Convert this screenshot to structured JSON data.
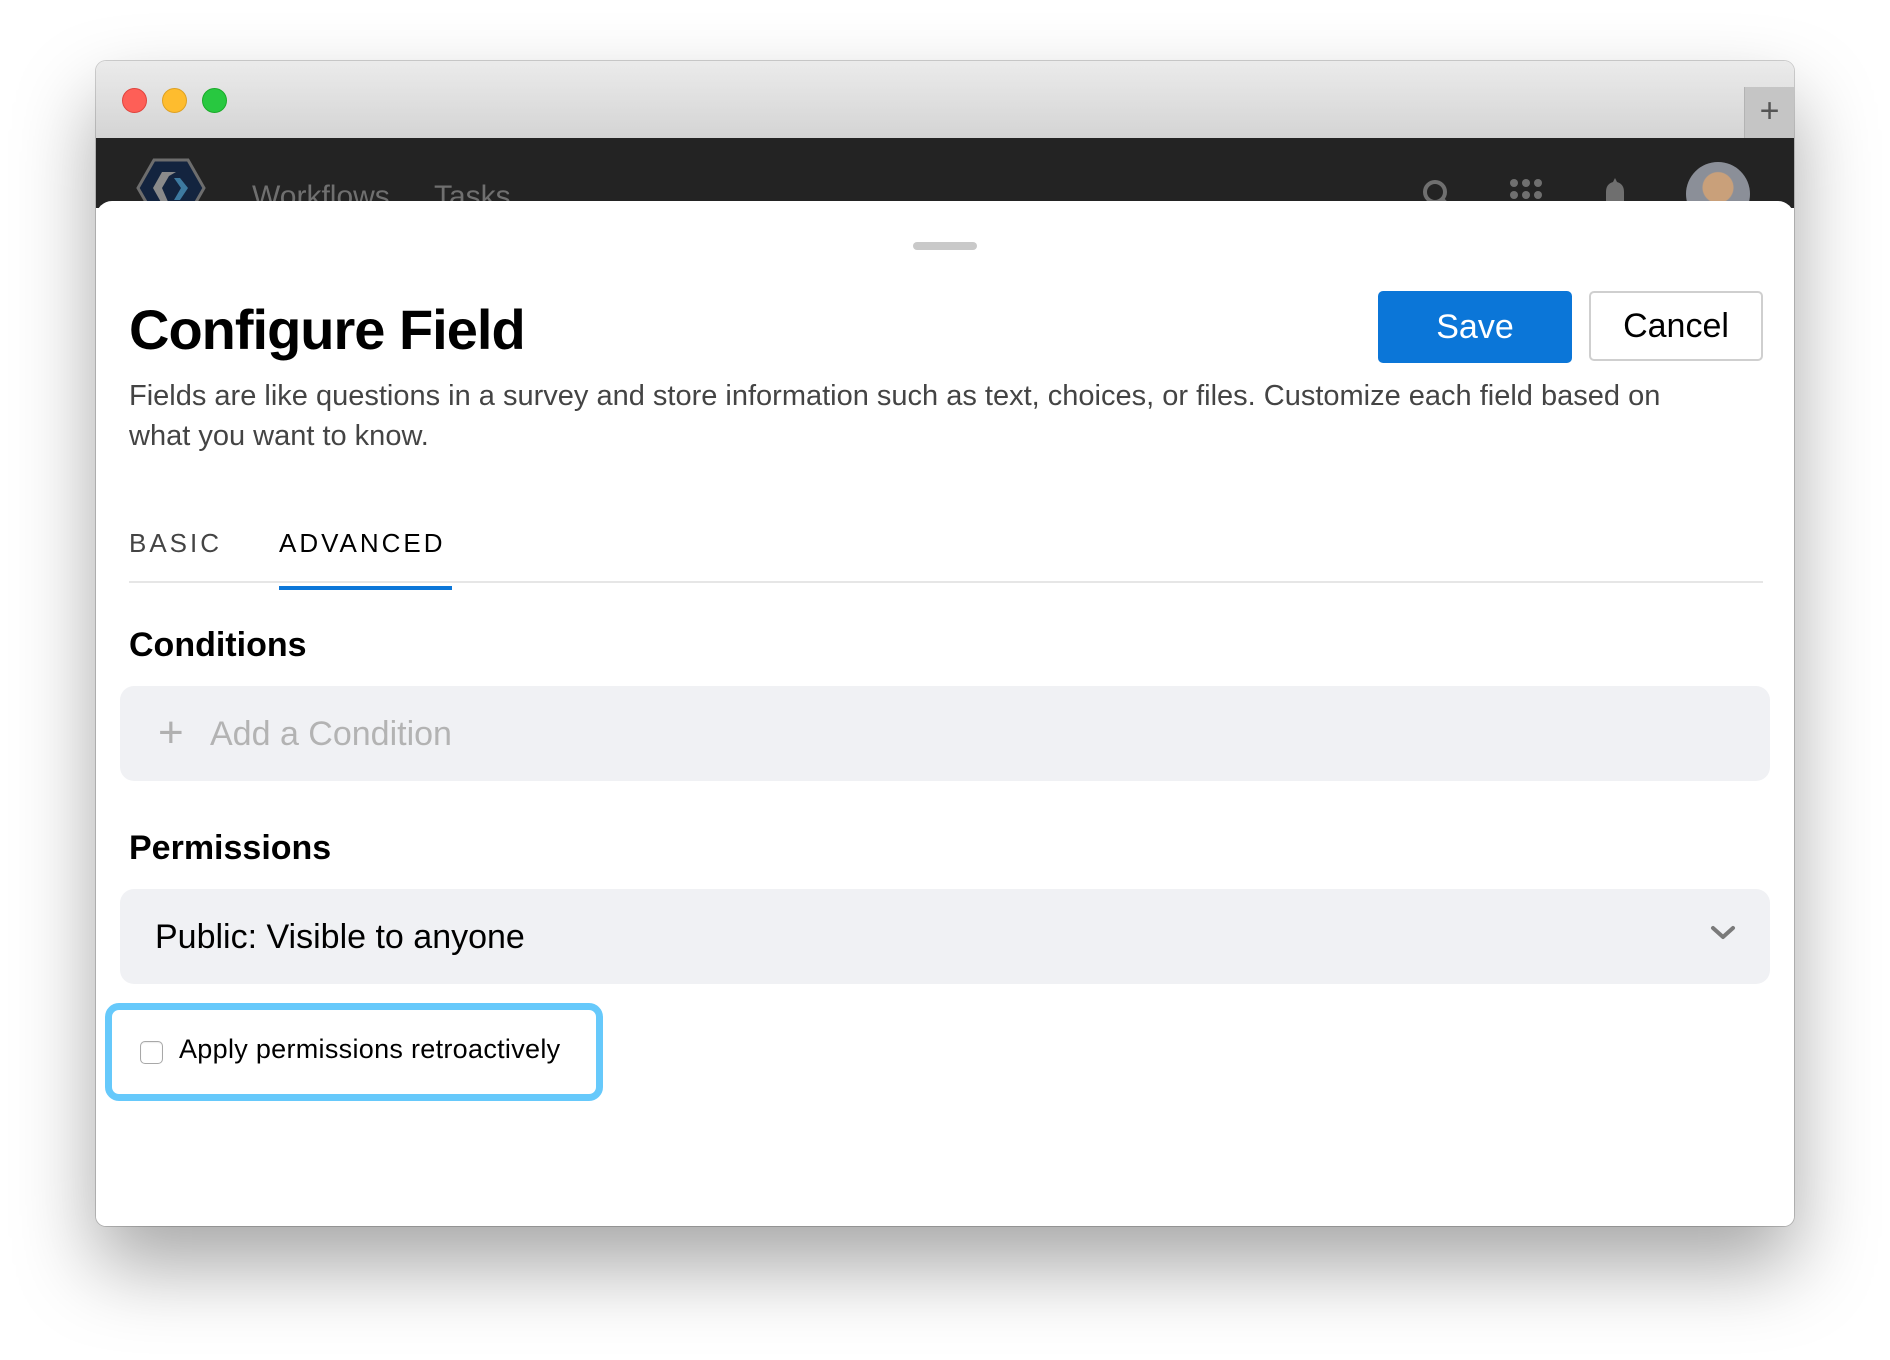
{
  "window": {
    "new_tab_label": "+"
  },
  "app_nav": {
    "links": [
      {
        "label": "Workflows"
      },
      {
        "label": "Tasks"
      }
    ],
    "icons": [
      "search-icon",
      "apps-grid-icon",
      "notification-bell-icon"
    ],
    "avatar": "user-avatar"
  },
  "sheet": {
    "title": "Configure Field",
    "description": "Fields are like questions in a survey and store information such as text, choices, or files. Customize each field based on what you want to know.",
    "actions": {
      "save_label": "Save",
      "cancel_label": "Cancel"
    },
    "tabs": [
      {
        "label": "BASIC",
        "active": false
      },
      {
        "label": "ADVANCED",
        "active": true
      }
    ],
    "conditions": {
      "heading": "Conditions",
      "add_label": "Add a Condition"
    },
    "permissions": {
      "heading": "Permissions",
      "selected": "Public: Visible to anyone",
      "retroactive_label": "Apply permissions retroactively",
      "retroactive_checked": false
    }
  },
  "colors": {
    "accent": "#0b76d8",
    "highlight": "#66c9fb",
    "nav_background": "#232323",
    "field_background": "#f0f1f4"
  }
}
